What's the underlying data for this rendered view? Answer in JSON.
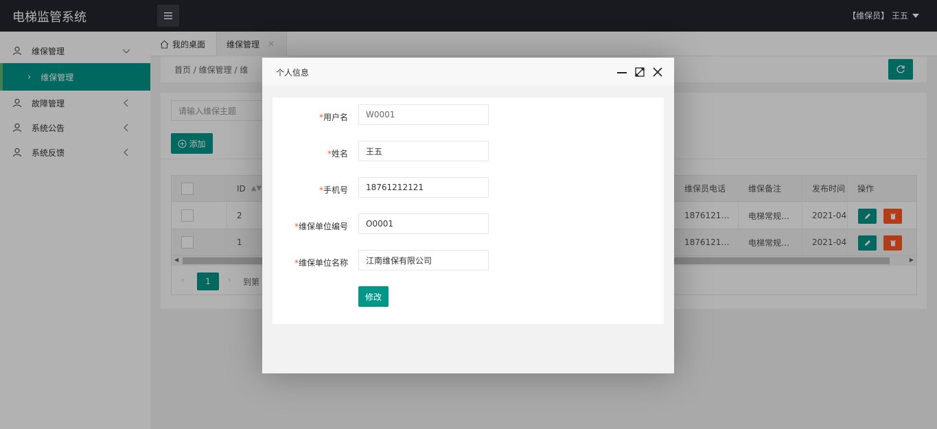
{
  "app": {
    "title": "电梯监管系统"
  },
  "user": {
    "role_name": "【维保员】 王五"
  },
  "sidebar": {
    "items": [
      {
        "label": "维保管理",
        "expanded": true,
        "children": [
          {
            "label": "维保管理"
          }
        ]
      },
      {
        "label": "故障管理"
      },
      {
        "label": "系统公告"
      },
      {
        "label": "系统反馈"
      }
    ]
  },
  "tabs": [
    {
      "label": "我的桌面"
    },
    {
      "label": "维保管理",
      "close": "✕"
    }
  ],
  "breadcrumb": {
    "text": "首页  /  维保管理  /  维"
  },
  "toolbar": {
    "search_placeholder": "请输入维保主题",
    "add_label": "添加"
  },
  "table": {
    "headers": {
      "id": "ID",
      "phone": "维保员电话",
      "remark": "维保备注",
      "time": "发布时间",
      "ops": "操作"
    },
    "rows": [
      {
        "id": "2",
        "phone": "1876121…",
        "remark": "电梯常规…",
        "time": "2021-04-…"
      },
      {
        "id": "1",
        "phone": "1876121…",
        "remark": "电梯常规…",
        "time": "2021-04-…"
      }
    ]
  },
  "pager": {
    "current": "1",
    "goto_label": "到第"
  },
  "modal": {
    "title": "个人信息",
    "fields": [
      {
        "required": "*",
        "label": "用户名",
        "value": "W0001"
      },
      {
        "required": "*",
        "label": "姓名",
        "value": "王五"
      },
      {
        "required": "*",
        "label": "手机号",
        "value": "18761212121"
      },
      {
        "required": "*",
        "label": "维保单位编号",
        "value": "O0001"
      },
      {
        "required": "*",
        "label": "维保单位名称",
        "value": "江南维保有限公司"
      }
    ],
    "submit_label": "修改"
  },
  "colors": {
    "primary": "#009688",
    "danger": "#ff5722",
    "header_bg": "#23262e"
  }
}
